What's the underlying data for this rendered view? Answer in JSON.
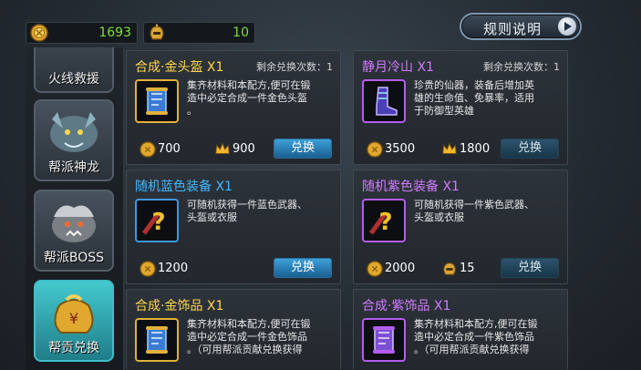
{
  "currencies": [
    {
      "icon": "gold-coin-icon",
      "value": "1693"
    },
    {
      "icon": "helmet-icon",
      "value": "10"
    }
  ],
  "rules_button": {
    "label": "规则说明"
  },
  "sidebar": {
    "items": [
      {
        "label": "火线救援",
        "active": false
      },
      {
        "label": "帮派神龙",
        "active": false
      },
      {
        "label": "帮派BOSS",
        "active": false
      },
      {
        "label": "帮贡兑换",
        "active": true
      }
    ]
  },
  "cards": [
    {
      "title": "合成·金头盔 X1",
      "title_color": "#ffd84a",
      "remain": "剩余兑换次数：1",
      "item_icon": "gold-scroll-icon",
      "desc": [
        "集齐材料和本配方,便可在锻",
        "造中必定合成一件金色头盔",
        "。"
      ],
      "cost1": {
        "icon": "gold-coin-icon",
        "value": "700"
      },
      "cost2": {
        "icon": "crown-icon",
        "value": "900"
      },
      "button": "兑换"
    },
    {
      "title": "静月冷山 X1",
      "title_color": "#d07bff",
      "remain": "剩余兑换次数：1",
      "item_icon": "purple-boots-icon",
      "desc": [
        "珍贵的仙器，装备后增加英",
        "雄的生命值、免暴率，适用",
        "于防御型英雄"
      ],
      "cost1": {
        "icon": "gold-coin-icon",
        "value": "3500"
      },
      "cost2": {
        "icon": "crown-icon",
        "value": "1800"
      },
      "button": "兑换"
    },
    {
      "title": "随机蓝色装备 X1",
      "title_color": "#43b8ff",
      "remain": "",
      "item_icon": "blue-mystery-icon",
      "desc": [
        "可随机获得一件蓝色武器、",
        "头盔或衣服"
      ],
      "cost1": {
        "icon": "gold-coin-icon",
        "value": "1200"
      },
      "cost2": null,
      "button": "兑换"
    },
    {
      "title": "随机紫色装备 X1",
      "title_color": "#d07bff",
      "remain": "",
      "item_icon": "purple-mystery-icon",
      "desc": [
        "可随机获得一件紫色武器、",
        "头盔或衣服"
      ],
      "cost1": {
        "icon": "gold-coin-icon",
        "value": "2000"
      },
      "cost2": {
        "icon": "helmet-icon",
        "value": "15"
      },
      "button": "兑换"
    },
    {
      "title": "合成·金饰品 X1",
      "title_color": "#ffd84a",
      "remain": "",
      "item_icon": "gold-scroll-icon",
      "desc": [
        "集齐材料和本配方,便可在锻",
        "造中必定合成一件金色饰品",
        "。（可用帮派贡献兑换获得"
      ],
      "cost1": null,
      "cost2": null,
      "button": ""
    },
    {
      "title": "合成·紫饰品 X1",
      "title_color": "#d07bff",
      "remain": "",
      "item_icon": "purple-scroll-icon",
      "desc": [
        "集齐材料和本配方,便可在锻",
        "造中必定合成一件紫色饰品",
        "。（可用帮派贡献兑换获得"
      ],
      "cost1": null,
      "cost2": null,
      "button": ""
    }
  ]
}
